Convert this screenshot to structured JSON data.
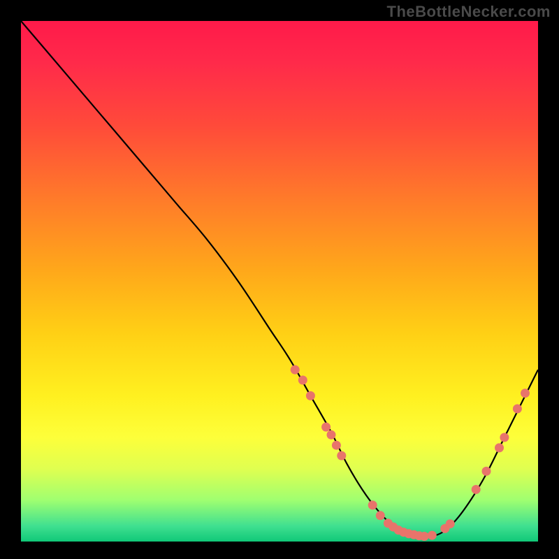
{
  "watermark": "TheBottleNecker.com",
  "chart_data": {
    "type": "line",
    "title": "",
    "xlabel": "",
    "ylabel": "",
    "xlim": [
      0,
      100
    ],
    "ylim": [
      0,
      100
    ],
    "x": [
      0,
      6,
      12,
      18,
      24,
      30,
      36,
      42,
      48,
      52,
      56,
      60,
      63,
      66,
      69,
      72,
      75,
      78,
      81,
      84,
      87,
      90,
      93,
      96,
      100
    ],
    "values": [
      100,
      93,
      86,
      79,
      72,
      65,
      58,
      50,
      41,
      35,
      28,
      21,
      15,
      10,
      6,
      3,
      1.5,
      1,
      1.5,
      4,
      8,
      13,
      19,
      25,
      33
    ],
    "markers": [
      {
        "x": 53,
        "y": 33
      },
      {
        "x": 54.5,
        "y": 31
      },
      {
        "x": 56,
        "y": 28
      },
      {
        "x": 59,
        "y": 22
      },
      {
        "x": 60,
        "y": 20.5
      },
      {
        "x": 61,
        "y": 18.5
      },
      {
        "x": 62,
        "y": 16.5
      },
      {
        "x": 68,
        "y": 7
      },
      {
        "x": 69.5,
        "y": 5
      },
      {
        "x": 71,
        "y": 3.5
      },
      {
        "x": 72,
        "y": 2.8
      },
      {
        "x": 73,
        "y": 2.2
      },
      {
        "x": 74,
        "y": 1.8
      },
      {
        "x": 75,
        "y": 1.5
      },
      {
        "x": 76,
        "y": 1.3
      },
      {
        "x": 77,
        "y": 1.1
      },
      {
        "x": 78,
        "y": 1.0
      },
      {
        "x": 79.5,
        "y": 1.2
      },
      {
        "x": 82,
        "y": 2.5
      },
      {
        "x": 83,
        "y": 3.4
      },
      {
        "x": 88,
        "y": 10
      },
      {
        "x": 90,
        "y": 13.5
      },
      {
        "x": 92.5,
        "y": 18
      },
      {
        "x": 93.5,
        "y": 20
      },
      {
        "x": 96,
        "y": 25.5
      },
      {
        "x": 97.5,
        "y": 28.5
      }
    ],
    "marker_color": "#e8746b",
    "line_color": "#000000"
  }
}
